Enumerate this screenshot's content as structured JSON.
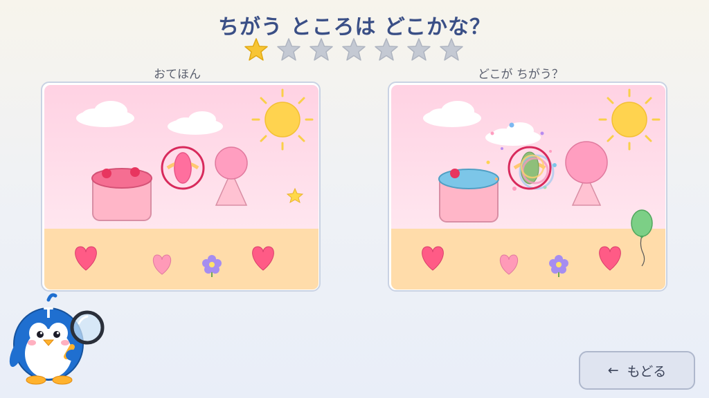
{
  "header": {
    "title": "ちがう ところは どこかな？"
  },
  "progress": {
    "found": 1,
    "total": 7
  },
  "panels": {
    "left_label": "おてほん",
    "right_label": "どこが ちがう？"
  },
  "back_button": {
    "arrow": "←",
    "label": "もどる"
  },
  "colors": {
    "title": "#3a4f86",
    "star_on": "#f7c534",
    "star_off": "#c4c9d3",
    "sky": "#ffd8e6",
    "ground": "#ffdca8",
    "found_ring": "#d82a5c"
  }
}
